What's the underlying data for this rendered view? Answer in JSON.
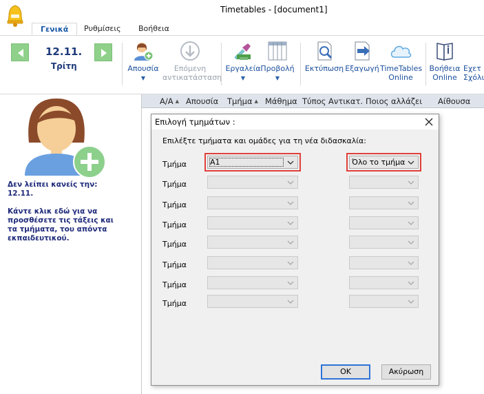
{
  "window": {
    "title": "Timetables - [document1]"
  },
  "ribbon": {
    "tabs": [
      {
        "label": "Γενικά"
      },
      {
        "label": "Ρυθμίσεις"
      },
      {
        "label": "Βοήθεια"
      }
    ],
    "date": {
      "value": "12.11.",
      "weekday": "Τρίτη"
    },
    "buttons": {
      "absence": "Απουσία",
      "next_sub_1": "Επόμενη",
      "next_sub_2": "αντικατάσταση",
      "tools": "Εργαλεία",
      "view": "Προβολή",
      "print": "Εκτύπωση",
      "export": "Εξαγωγή",
      "tt_online_1": "TimeTables",
      "tt_online_2": "Online",
      "help_online_1": "Βοήθεια",
      "help_online_2": "Online",
      "exec_1": "Εχετ",
      "exec_2": "Σχόλι"
    },
    "colors": {
      "accent": "#1b4f9c",
      "nav_green": "#8fd18a"
    }
  },
  "left_panel": {
    "line1": "Δεν λείπει κανείς την:",
    "line2": "12.11.",
    "line3": "Κάντε κλικ εδώ για να προσθέσετε τις τάξεις και τα τμήματα, του απόντα εκπαιδευτικού."
  },
  "grid": {
    "columns": [
      "Α/Α",
      "Απουσία",
      "Τμήμα",
      "Μάθημα",
      "Τύπος Αντικατ.",
      "Ποιος αλλάζει",
      "Αίθουσα"
    ]
  },
  "dialog": {
    "title": "Επιλογή τμημάτων :",
    "instruction": "Επιλέξτε τμήματα και ομάδες για τη νέα διδασκαλία:",
    "row_label": "Τμήμα",
    "rows": [
      {
        "class_value": "Α1",
        "group_value": "Όλο το τμήμα"
      },
      {
        "class_value": "",
        "group_value": ""
      },
      {
        "class_value": "",
        "group_value": ""
      },
      {
        "class_value": "",
        "group_value": ""
      },
      {
        "class_value": "",
        "group_value": ""
      },
      {
        "class_value": "",
        "group_value": ""
      },
      {
        "class_value": "",
        "group_value": ""
      },
      {
        "class_value": "",
        "group_value": ""
      }
    ],
    "ok_label": "OK",
    "cancel_label": "Ακύρωση",
    "highlight_color": "#e0403a"
  }
}
